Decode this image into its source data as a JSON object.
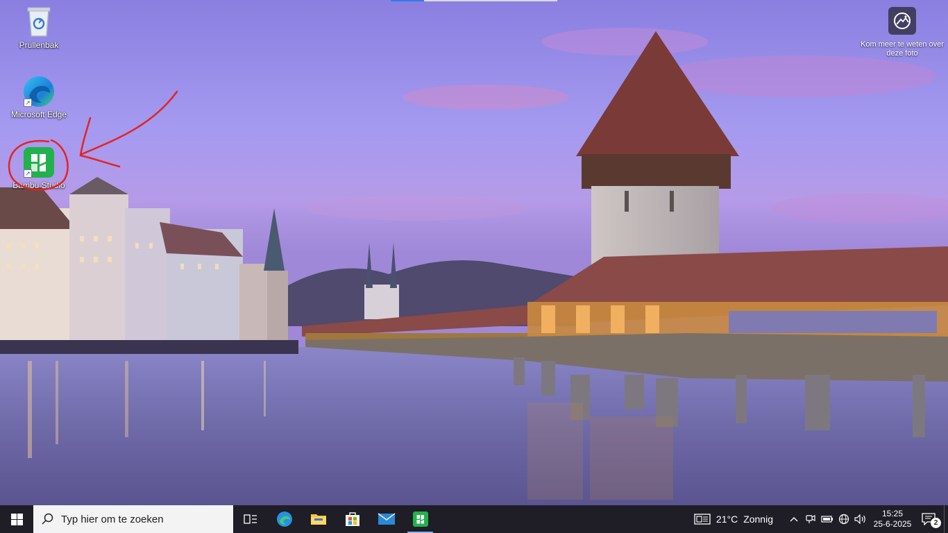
{
  "desktop": {
    "icons": [
      {
        "label": "Prullenbak",
        "icon": "recycle-bin-icon"
      },
      {
        "label": "Microsoft Edge",
        "icon": "edge-icon"
      },
      {
        "label": "Bambu Studio",
        "icon": "bambu-studio-icon"
      }
    ],
    "spotlight": {
      "label": "Kom meer te weten over deze foto",
      "icon": "camera-icon"
    },
    "annotation_color": "#e52222"
  },
  "taskbar": {
    "start_icon": "windows-logo-icon",
    "search_placeholder": "Typ hier om te zoeken",
    "pinned": [
      {
        "name": "task-view",
        "icon": "task-view-icon"
      },
      {
        "name": "edge",
        "icon": "edge-icon"
      },
      {
        "name": "file-explorer",
        "icon": "folder-icon"
      },
      {
        "name": "microsoft-store",
        "icon": "store-icon"
      },
      {
        "name": "mail",
        "icon": "mail-icon"
      },
      {
        "name": "bambu-studio",
        "icon": "bambu-studio-icon",
        "active": true
      }
    ],
    "weather": {
      "temp": "21°C",
      "condition": "Zonnig"
    },
    "clock": {
      "time": "15:25",
      "date": "25-6-2025"
    },
    "notification_count": "2"
  }
}
